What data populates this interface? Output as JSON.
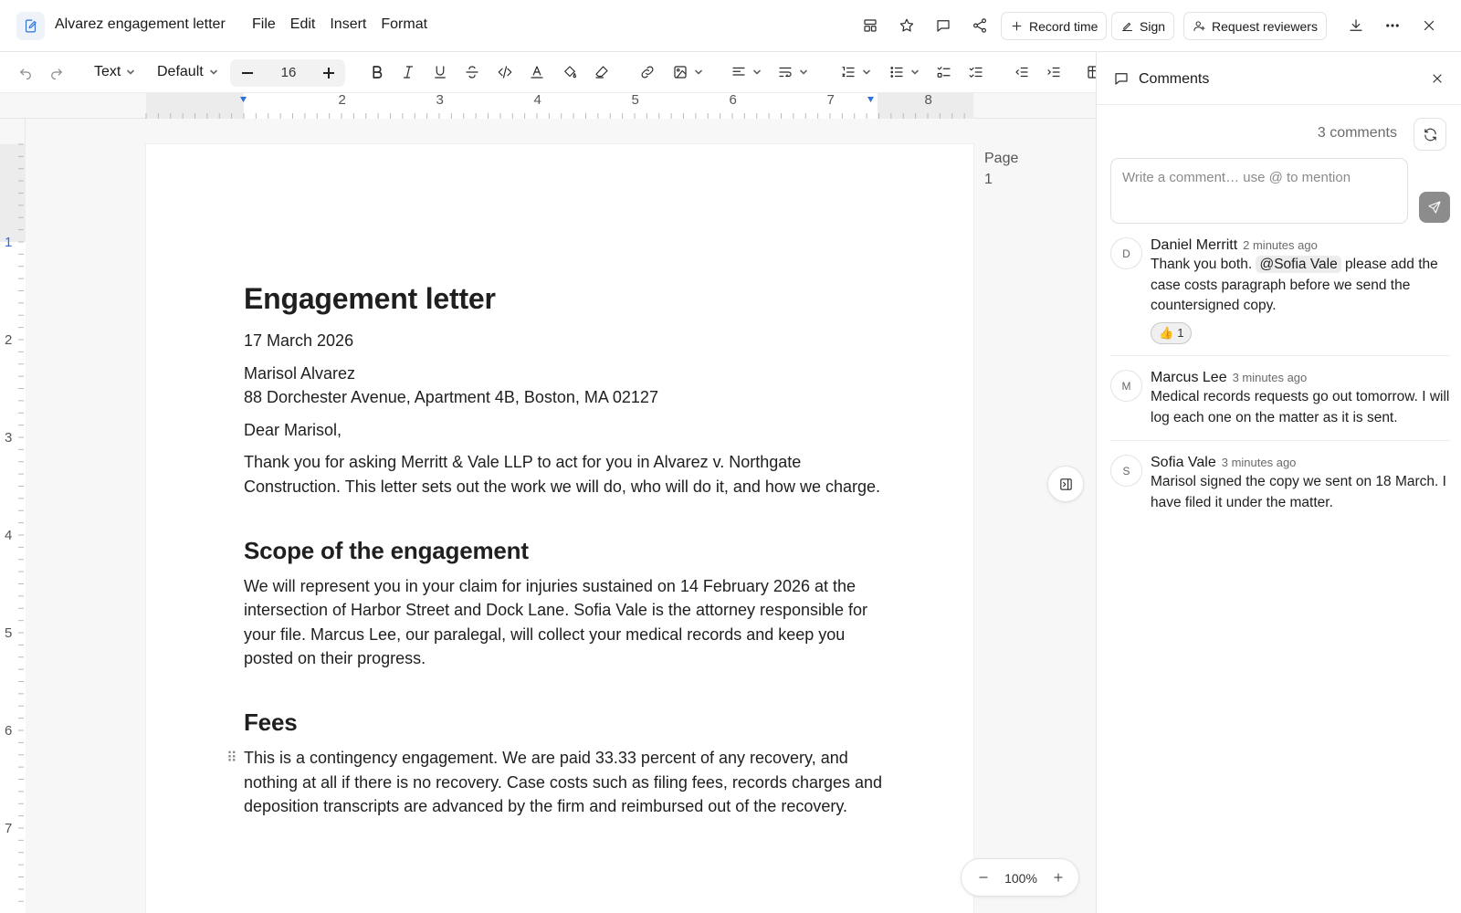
{
  "app": {
    "doc_title": "Alvarez engagement letter",
    "menus": [
      "File",
      "Edit",
      "Insert",
      "Format"
    ]
  },
  "topbar": {
    "record_time": "Record time",
    "sign": "Sign",
    "request_reviewers": "Request reviewers"
  },
  "toolbar": {
    "block_type": "Text",
    "font": "Default",
    "font_size": "16"
  },
  "ruler": {
    "h_ticks": [
      "2",
      "3",
      "4",
      "5",
      "6",
      "7",
      "8"
    ],
    "v_ticks": [
      "1",
      "2",
      "3",
      "4",
      "5",
      "6",
      "7"
    ]
  },
  "document": {
    "title": "Engagement letter",
    "date": "17 March 2026",
    "recipient_name": "Marisol Alvarez",
    "recipient_address": "88 Dorchester Avenue, Apartment 4B, Boston, MA 02127",
    "salutation": "Dear Marisol,",
    "intro": "Thank you for asking Merritt & Vale LLP to act for you in Alvarez v. Northgate Construction. This letter sets out the work we will do, who will do it, and how we charge.",
    "scope_heading": "Scope of the engagement",
    "scope_text": "We will represent you in your claim for injuries sustained on 14 February 2026 at the intersection of Harbor Street and Dock Lane. Sofia Vale is the attorney responsible for your file. Marcus Lee, our paralegal, will collect your medical records and keep you posted on their progress.",
    "fees_heading": "Fees",
    "fees_text": "This is a contingency engagement. We are paid 33.33 percent of any recovery, and nothing at all if there is no recovery. Case costs such as filing fees, records charges and deposition transcripts are advanced by the firm and reimbursed out of the recovery."
  },
  "page_label": {
    "label": "Page",
    "number": "1"
  },
  "zoom": {
    "value": "100%"
  },
  "comments_panel": {
    "title": "Comments",
    "count": "3 comments",
    "input_placeholder": "Write a comment… use @ to mention",
    "comments": [
      {
        "initial": "D",
        "author": "Daniel Merritt",
        "time": "2 minutes ago",
        "text_before": "Thank you both.",
        "mention": "@Sofia Vale",
        "text_after": "please add the case costs paragraph before we send the countersigned copy.",
        "reaction_emoji": "👍",
        "reaction_count": "1"
      },
      {
        "initial": "M",
        "author": "Marcus Lee",
        "time": "3 minutes ago",
        "text": "Medical records requests go out tomorrow. I will log each one on the matter as it is sent."
      },
      {
        "initial": "S",
        "author": "Sofia Vale",
        "time": "3 minutes ago",
        "text": "Marisol signed the copy we sent on 18 March. I have filed it under the matter."
      }
    ]
  },
  "colors": {
    "accent": "#2f6fd6",
    "send_button": "#8c8c8c"
  }
}
